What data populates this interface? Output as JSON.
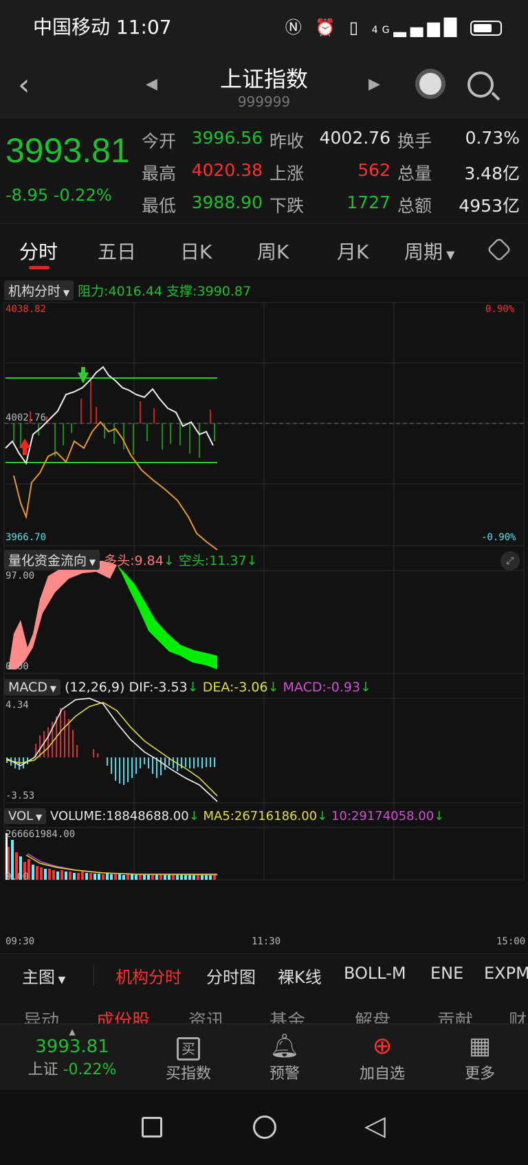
{
  "status": {
    "carrier_time": "中国移动 11:07",
    "signal_text": "4G"
  },
  "header": {
    "title": "上证指数",
    "code": "999999"
  },
  "quote": {
    "price": "3993.81",
    "change": "-8.95",
    "change_pct": "-0.22%",
    "rows": [
      {
        "l1": "今开",
        "v1": "3996.56",
        "l2": "昨收",
        "v2": "4002.76",
        "l3": "换手",
        "v3": "0.73%"
      },
      {
        "l1": "最高",
        "v1": "4020.38",
        "l2": "上涨",
        "v2": "562",
        "l3": "总量",
        "v3": "3.48亿"
      },
      {
        "l1": "最低",
        "v1": "3988.90",
        "l2": "下跌",
        "v2": "1727",
        "l3": "总额",
        "v3": "4953亿"
      }
    ],
    "colors": {
      "up": "#ff3030",
      "down": "#1fbf2f"
    }
  },
  "tabs": [
    "分时",
    "五日",
    "日K",
    "周K",
    "月K",
    "周期"
  ],
  "intraday": {
    "selector": "机构分时",
    "resistance": "阻力:4016.44",
    "support": "支撑:3990.87",
    "high_label": "4038.82",
    "mid_label": "4002.76",
    "low_label": "3966.70",
    "pct_high": "0.90%",
    "pct_low": "-0.90%"
  },
  "flow": {
    "selector": "量化资金流向",
    "bull": "多头:9.84",
    "bear": "空头:11.37",
    "max_label": "97.00",
    "min_label": "0.00"
  },
  "macd": {
    "selector": "MACD",
    "params": "(12,26,9)",
    "dif": "DIF:-3.53",
    "dea": "DEA:-3.06",
    "macd": "MACD:-0.93",
    "max_label": "4.34",
    "min_label": "-3.53"
  },
  "vol": {
    "selector": "VOL",
    "volume": "VOLUME:18848688.00",
    "ma5": "MA5:26716186.00",
    "ma10": "10:29174058.00",
    "max_label": "266661984.00",
    "min_label": "0.00"
  },
  "time_axis": [
    "09:30",
    "11:30",
    "15:00"
  ],
  "main_toolbar": [
    "主图",
    "机构分时",
    "分时图",
    "裸K线",
    "BOLL-M",
    "ENE",
    "EXPM"
  ],
  "sub_tabs": [
    "异动",
    "成份股",
    "资讯",
    "基金",
    "解盘",
    "贡献",
    "财"
  ],
  "bottom_nav": {
    "mini_price": "3993.81",
    "mini_name": "上证",
    "mini_pct": "-0.22%",
    "items": [
      {
        "label": "买指数",
        "icon": "buy-icon"
      },
      {
        "label": "预警",
        "icon": "bell-icon"
      },
      {
        "label": "加自选",
        "icon": "add-circle-icon"
      },
      {
        "label": "更多",
        "icon": "grid-icon"
      }
    ],
    "buy_glyph": "买"
  }
}
